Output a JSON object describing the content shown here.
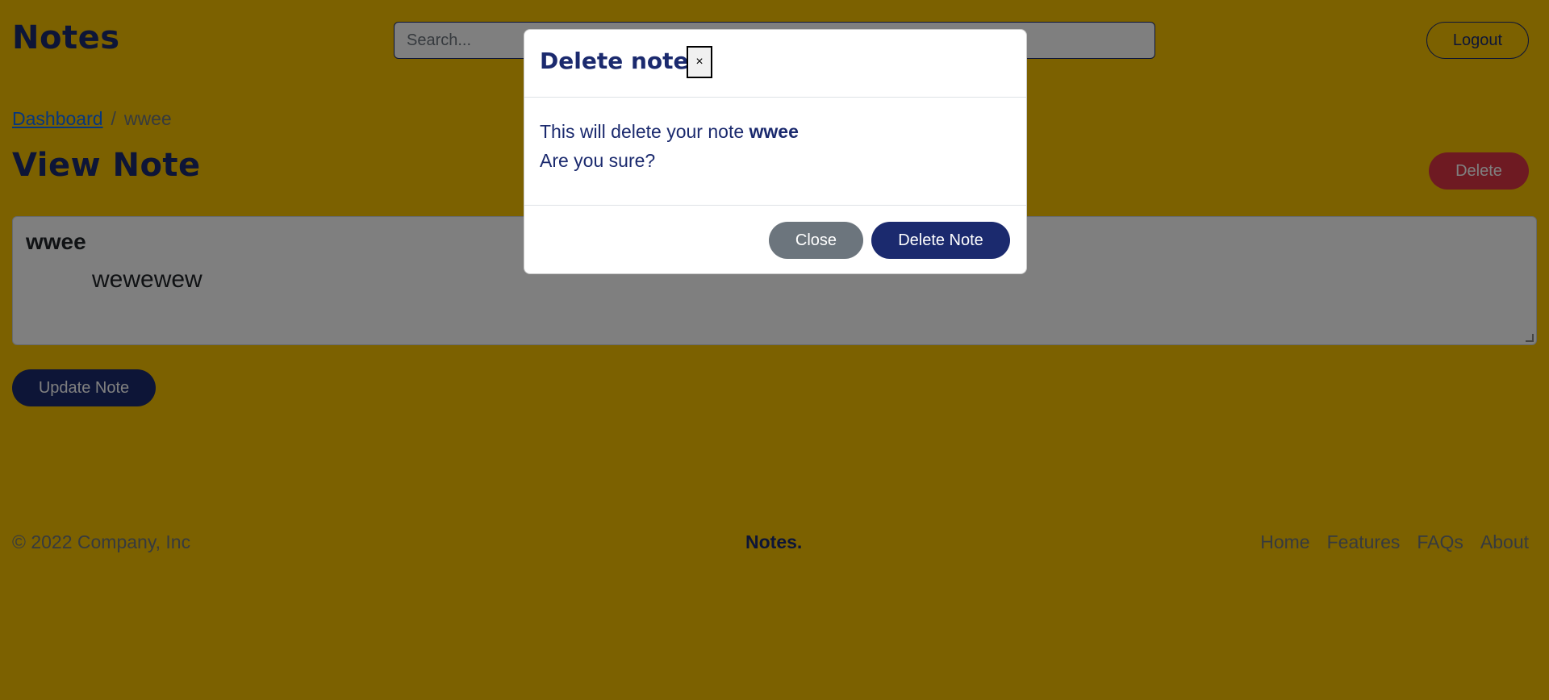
{
  "header": {
    "brand": "Notes",
    "search_placeholder": "Search...",
    "logout_label": "Logout"
  },
  "breadcrumb": {
    "link": "Dashboard",
    "separator": "/",
    "current": "wwee"
  },
  "main": {
    "title": "View Note",
    "delete_label": "Delete",
    "note_title": "wwee",
    "note_body": "wewewew",
    "update_label": "Update Note"
  },
  "footer": {
    "copyright": "© 2022 Company, Inc",
    "brand": "Notes.",
    "nav": [
      "Home",
      "Features",
      "FAQs",
      "About"
    ]
  },
  "modal": {
    "title": "Delete note",
    "close_x": "×",
    "message_prefix": "This will delete your note",
    "note_name": "wwee",
    "question": "Are you sure?",
    "close_label": "Close",
    "confirm_label": "Delete Note"
  },
  "colors": {
    "background": "#f9c300",
    "primary": "#1b2a6e",
    "danger": "#dc3545",
    "secondary": "#6c757d",
    "link": "#0d6efd"
  }
}
